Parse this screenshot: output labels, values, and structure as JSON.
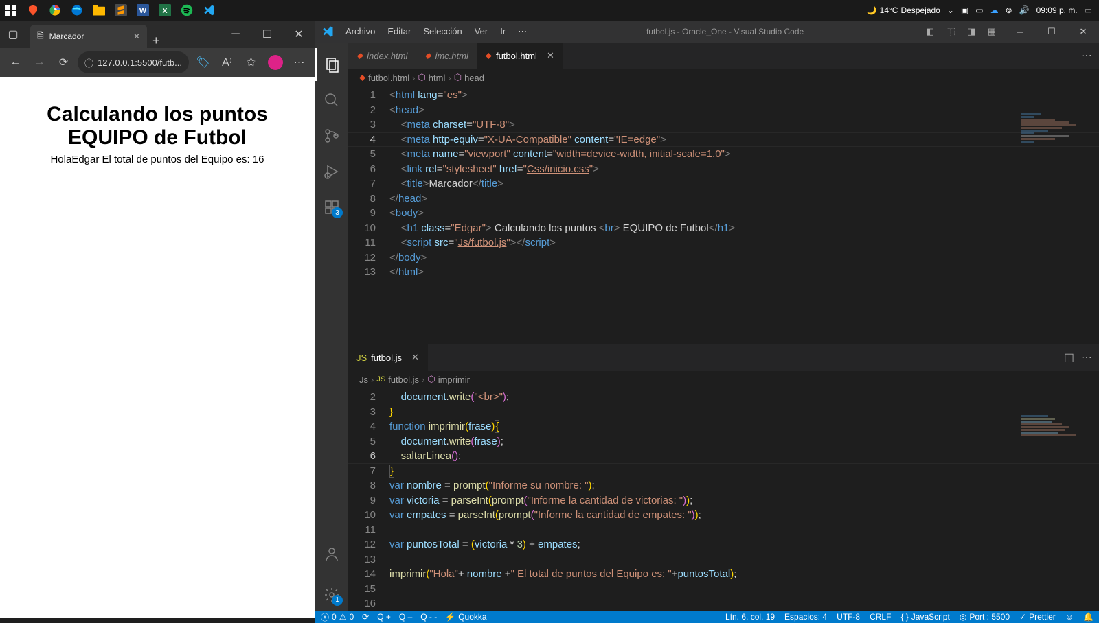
{
  "taskbar": {
    "weather_temp": "14°C",
    "weather_desc": "Despejado",
    "time": "09:09 p. m."
  },
  "browser": {
    "tab_title": "Marcador",
    "url": "127.0.0.1:5500/futb...",
    "page": {
      "h1_line1": "Calculando los puntos",
      "h1_line2": "EQUIPO de Futbol",
      "body_text": "HolaEdgar El total de puntos del Equipo es: 16"
    }
  },
  "vscode": {
    "menu": [
      "Archivo",
      "Editar",
      "Selección",
      "Ver",
      "Ir"
    ],
    "title": "futbol.js - Oracle_One - Visual Studio Code",
    "activity_badge_ext": "3",
    "activity_badge_settings": "1",
    "tabs_top": [
      {
        "label": "index.html",
        "active": false,
        "italic": true,
        "close": false
      },
      {
        "label": "imc.html",
        "active": false,
        "italic": true,
        "close": false
      },
      {
        "label": "futbol.html",
        "active": true,
        "italic": false,
        "close": true
      }
    ],
    "tabs_bottom": [
      {
        "label": "futbol.js",
        "active": true,
        "close": true
      }
    ],
    "breadcrumb_top": [
      "futbol.html",
      "html",
      "head"
    ],
    "breadcrumb_bottom": [
      "Js",
      "futbol.js",
      "imprimir"
    ],
    "status": {
      "errors": "0",
      "warnings": "0",
      "quokka_plus": "Q +",
      "quokka_minus": "Q  –",
      "quokka_dash": "Q  - -",
      "quokka_label": "Quokka",
      "pos": "Lín. 6, col. 19",
      "spaces": "Espacios: 4",
      "encoding": "UTF-8",
      "eol": "CRLF",
      "lang": "JavaScript",
      "port": "Port : 5500",
      "prettier": "Prettier"
    },
    "code_top": {
      "lines": [
        1,
        2,
        3,
        4,
        5,
        6,
        7,
        8,
        9,
        10,
        11,
        12,
        13
      ],
      "active_line": 4
    },
    "code_bottom": {
      "lines": [
        2,
        3,
        4,
        5,
        6,
        7,
        8,
        9,
        10,
        11,
        12,
        13,
        14,
        15,
        16
      ],
      "active_line": 6
    }
  }
}
